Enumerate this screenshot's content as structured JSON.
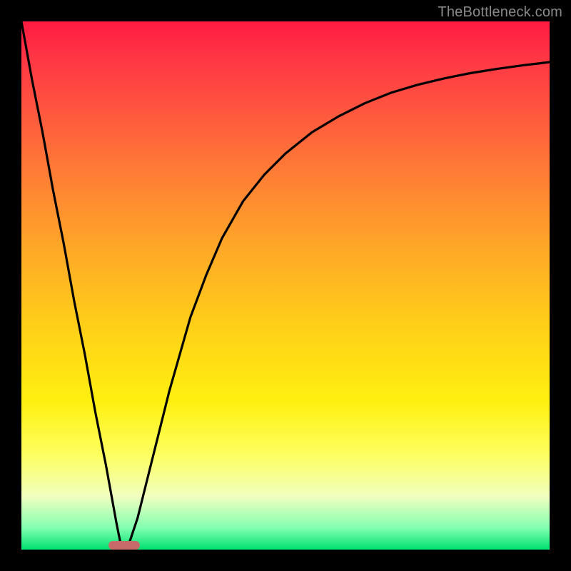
{
  "watermark": "TheBottleneck.com",
  "colors": {
    "frame": "#000000",
    "gradient_top": "#ff1a40",
    "gradient_bottom": "#00e070",
    "curve": "#000000",
    "marker": "#c86a6a",
    "watermark_text": "#8a8a8a"
  },
  "chart_data": {
    "type": "line",
    "title": "",
    "xlabel": "",
    "ylabel": "",
    "xlim": [
      0,
      100
    ],
    "ylim": [
      0,
      100
    ],
    "grid": false,
    "legend": false,
    "background": "heatmap-gradient red→yellow→green (vertical)",
    "x": [
      0,
      2,
      4,
      6,
      8,
      10,
      12,
      14,
      16,
      18,
      19,
      20,
      22,
      24,
      26,
      28,
      30,
      32,
      35,
      38,
      42,
      46,
      50,
      55,
      60,
      65,
      70,
      75,
      80,
      85,
      90,
      95,
      100
    ],
    "y": [
      100,
      89,
      79,
      68,
      58,
      47,
      37,
      26,
      16,
      5,
      0,
      0,
      6,
      14,
      22,
      30,
      37,
      44,
      52,
      59,
      66,
      71,
      75,
      79,
      82,
      84.5,
      86.5,
      88,
      89.2,
      90.2,
      91,
      91.7,
      92.3
    ],
    "marker": {
      "x_center": 19.5,
      "y": 0,
      "width_pct": 6
    },
    "notes": "V-shaped black curve on a red-to-green vertical heat gradient; small rounded pink marker sits at the curve minimum along the bottom edge. No axis ticks or numeric labels are visible, so x/y are normalized 0–100 estimates read from the plot area."
  }
}
